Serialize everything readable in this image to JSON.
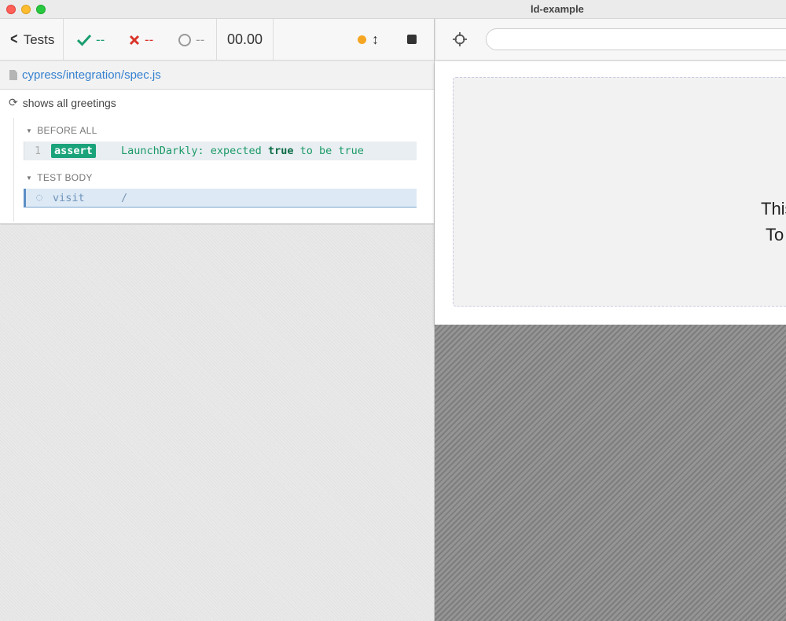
{
  "window": {
    "title": "ld-example"
  },
  "header": {
    "tests_label": "Tests",
    "passed": "--",
    "failed": "--",
    "pending": "--",
    "timer": "00.00"
  },
  "spec": {
    "path": "cypress/integration/spec.js"
  },
  "test": {
    "title": "shows all greetings",
    "before_all_label": "BEFORE ALL",
    "test_body_label": "TEST BODY",
    "assert_cmd": {
      "number": "1",
      "name": "assert",
      "message_prefix": "LaunchDarkly: expected",
      "message_value1": "true",
      "message_mid": "to be",
      "message_value2": "true"
    },
    "visit_cmd": {
      "name": "visit",
      "url": "/"
    }
  },
  "aut": {
    "url_value": "",
    "line1": "This",
    "line2": "To"
  },
  "colors": {
    "pass": "#1b9e6f",
    "fail": "#d9352a",
    "link": "#3380d0",
    "running": "#f5a623"
  }
}
